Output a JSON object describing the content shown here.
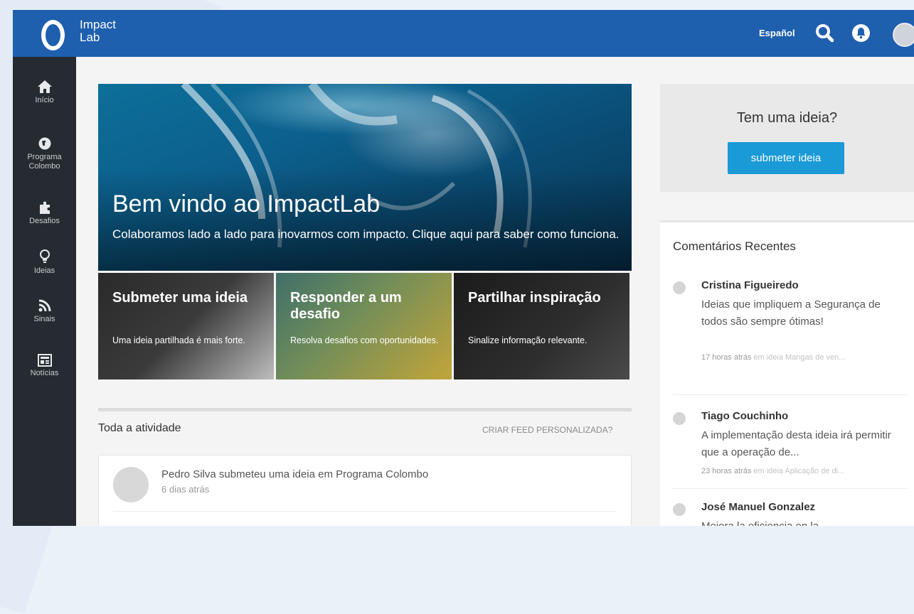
{
  "header": {
    "logo_line1": "Impact",
    "logo_line2": "Lab",
    "language": "Español"
  },
  "sidebar": {
    "items": [
      {
        "label": "Início",
        "icon": "home-icon"
      },
      {
        "label_line1": "Programa",
        "label_line2": "Colombo",
        "icon": "globe-icon"
      },
      {
        "label": "Desafios",
        "icon": "puzzle-icon"
      },
      {
        "label": "Ideias",
        "icon": "lightbulb-icon"
      },
      {
        "label": "Sinais",
        "icon": "rss-icon"
      },
      {
        "label": "Notícias",
        "icon": "newspaper-icon"
      }
    ]
  },
  "hero": {
    "title": "Bem vindo ao ImpactLab",
    "subtitle": "Colaboramos lado a lado para inovarmos com impacto. Clique aqui para saber como funciona."
  },
  "tiles": [
    {
      "title": "Submeter uma ideia",
      "desc": "Uma ideia partilhada é mais forte."
    },
    {
      "title": "Responder a um desafio",
      "desc": "Resolva desafios com oportunidades."
    },
    {
      "title": "Partilhar inspiração",
      "desc": "Sinalize informação relevante."
    }
  ],
  "feed": {
    "title": "Toda a atividade",
    "custom_link": "CRIAR FEED PERSONALIZADA?",
    "activity": {
      "user": "Pedro Silva",
      "action": "submeteu uma ideia em Programa Colombo",
      "time": "6 dias atrás"
    }
  },
  "idea_box": {
    "question": "Tem uma ideia?",
    "button": "submeter ideia"
  },
  "comments": {
    "title": "Comentários Recentes",
    "items": [
      {
        "name": "Cristina Figueiredo",
        "text": "Ideias que impliquem a Segurança de todos são sempre ótimas!",
        "time": "17 horas atrás",
        "source": "em ideia Mangas de ven..."
      },
      {
        "name": "Tiago Couchinho",
        "text": "A implementação desta ideia irá permitir que a operação de...",
        "time": "23 horas atrás",
        "source": "em ideia Aplicação de di..."
      },
      {
        "name": "José Manuel Gonzalez",
        "text": "Mejora la eficiencia en la"
      }
    ]
  },
  "colors": {
    "header_blue": "#1e5fae",
    "sidebar_dark": "#262b31",
    "button_blue": "#1a9ad6"
  }
}
